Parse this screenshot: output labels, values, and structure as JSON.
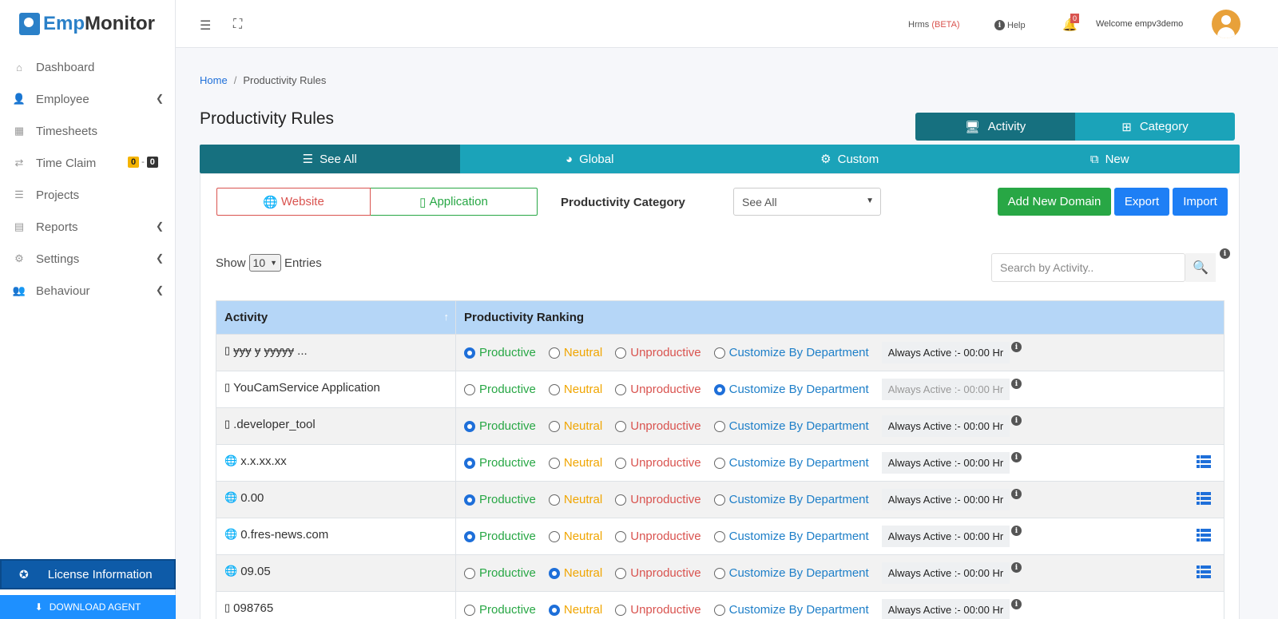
{
  "app": {
    "logo_part1": "Emp",
    "logo_part2": "Monitor"
  },
  "sidebar": {
    "items": [
      {
        "label": "Dashboard",
        "icon": "home-icon"
      },
      {
        "label": "Employee",
        "icon": "user-icon"
      },
      {
        "label": "Timesheets",
        "icon": "calendar-icon"
      },
      {
        "label": "Time Claim",
        "icon": "exchange-icon"
      },
      {
        "label": "Projects",
        "icon": "tasks-icon"
      },
      {
        "label": "Reports",
        "icon": "report-icon"
      },
      {
        "label": "Settings",
        "icon": "gear-icon"
      },
      {
        "label": "Behaviour",
        "icon": "user-gear-icon"
      }
    ],
    "time_claim_badge_1": "0",
    "time_claim_badge_sep": "-",
    "time_claim_badge_2": "0",
    "license": "License Information",
    "download": "DOWNLOAD AGENT"
  },
  "topbar": {
    "hrms": "Hrms",
    "beta": "(BETA)",
    "help": "Help",
    "notif_count": "0",
    "welcome": "Welcome  empv3demo"
  },
  "breadcrumb": {
    "home": "Home",
    "sep": "/",
    "current": "Productivity Rules"
  },
  "page_title": "Productivity Rules",
  "type_toggle": {
    "activity": "Activity",
    "category": "Category"
  },
  "filters": {
    "see_all": "See All",
    "global": "Global",
    "custom": "Custom",
    "new": "New"
  },
  "card": {
    "website": "Website",
    "application": "Application",
    "category_label": "Productivity Category",
    "category_value": "See All",
    "add_domain": "Add New Domain",
    "export": "Export",
    "import": "Import",
    "show": "Show",
    "show_value": "10",
    "entries": "Entries",
    "search_placeholder": "Search by Activity.."
  },
  "table": {
    "col_activity": "Activity",
    "col_ranking": "Productivity Ranking",
    "opt_productive": "Productive",
    "opt_neutral": "Neutral",
    "opt_unproductive": "Unproductive",
    "opt_custom": "Customize By Department",
    "rows": [
      {
        "activity": "ɏɏɏ ɏ ɏɏɏɏɏ ...",
        "type": "app",
        "selected": "productive",
        "always": "Always Active :- 00:00 Hr",
        "dim": false,
        "list": false
      },
      {
        "activity": "YouCamService Application",
        "type": "app",
        "selected": "custom",
        "always": "Always Active :- 00:00 Hr",
        "dim": true,
        "list": false
      },
      {
        "activity": ".developer_tool",
        "type": "app",
        "selected": "productive",
        "always": "Always Active :- 00:00 Hr",
        "dim": false,
        "list": false
      },
      {
        "activity": "x.x.xx.xx",
        "type": "web",
        "selected": "productive",
        "always": "Always Active :- 00:00 Hr",
        "dim": false,
        "list": true
      },
      {
        "activity": "0.00",
        "type": "web",
        "selected": "productive",
        "always": "Always Active :- 00:00 Hr",
        "dim": false,
        "list": true
      },
      {
        "activity": "0.fres-news.com",
        "type": "web",
        "selected": "productive",
        "always": "Always Active :- 00:00 Hr",
        "dim": false,
        "list": true
      },
      {
        "activity": "09.05",
        "type": "web",
        "selected": "neutral",
        "always": "Always Active :- 00:00 Hr",
        "dim": false,
        "list": true
      },
      {
        "activity": "098765",
        "type": "app",
        "selected": "neutral",
        "always": "Always Active :- 00:00 Hr",
        "dim": false,
        "list": false
      }
    ]
  }
}
